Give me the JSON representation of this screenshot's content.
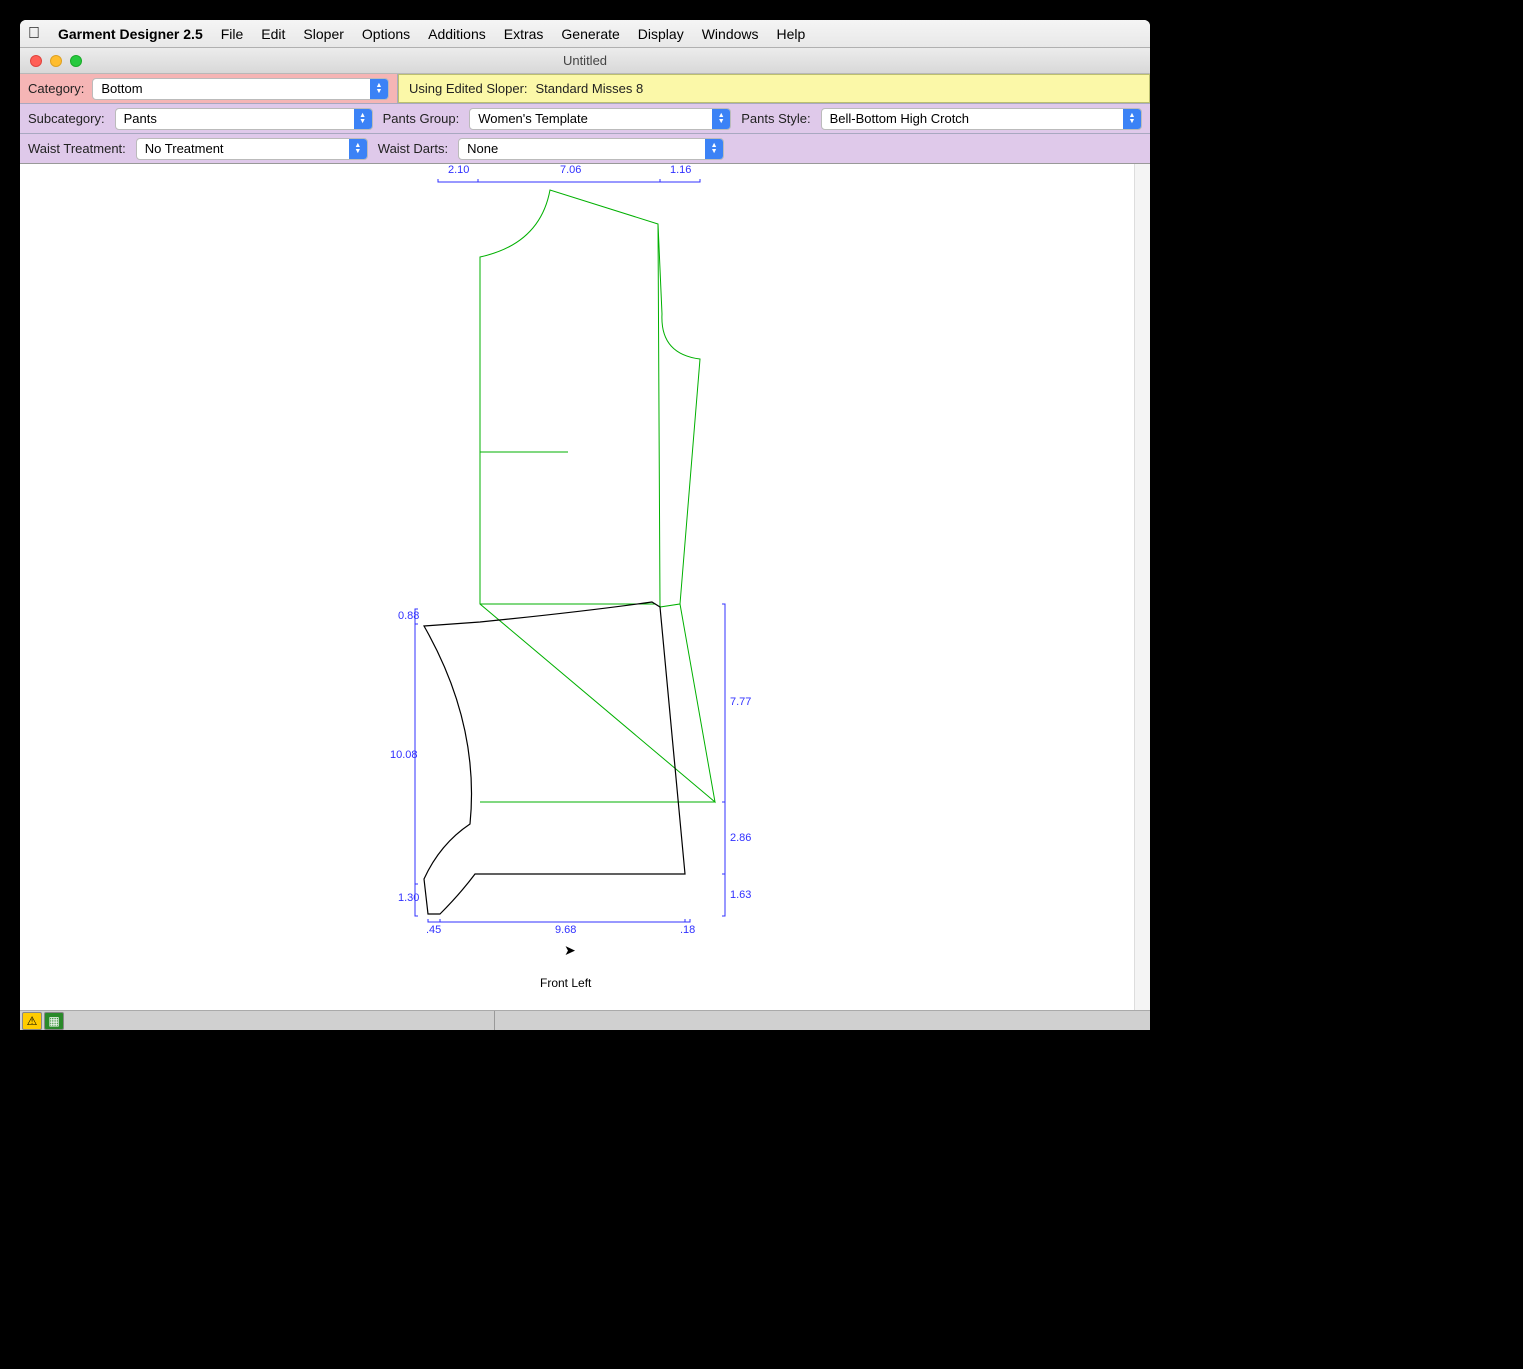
{
  "app": {
    "name": "Garment Designer 2.5"
  },
  "menu": [
    "File",
    "Edit",
    "Sloper",
    "Options",
    "Additions",
    "Extras",
    "Generate",
    "Display",
    "Windows",
    "Help"
  ],
  "window": {
    "title": "Untitled"
  },
  "row1": {
    "category_label": "Category:",
    "category_value": "Bottom",
    "sloper_label": "Using Edited Sloper:",
    "sloper_value": "Standard Misses 8"
  },
  "row2": {
    "subcategory_label": "Subcategory:",
    "subcategory_value": "Pants",
    "pantsgroup_label": "Pants Group:",
    "pantsgroup_value": "Women's Template",
    "pantsstyle_label": "Pants Style:",
    "pantsstyle_value": "Bell-Bottom High Crotch"
  },
  "row3": {
    "waisttreatment_label": "Waist Treatment:",
    "waisttreatment_value": "No Treatment",
    "waistdarts_label": "Waist Darts:",
    "waistdarts_value": "None"
  },
  "measurements": {
    "top1": "2.10",
    "top2": "7.06",
    "top3": "1.16",
    "left1": "0.88",
    "left2": "10.08",
    "left3": "1.30",
    "right1": "7.77",
    "right2": "2.86",
    "right3": "1.63",
    "bottom1": ".45",
    "bottom2": "9.68",
    "bottom3": ".18"
  },
  "canvas_label": "Front Left"
}
